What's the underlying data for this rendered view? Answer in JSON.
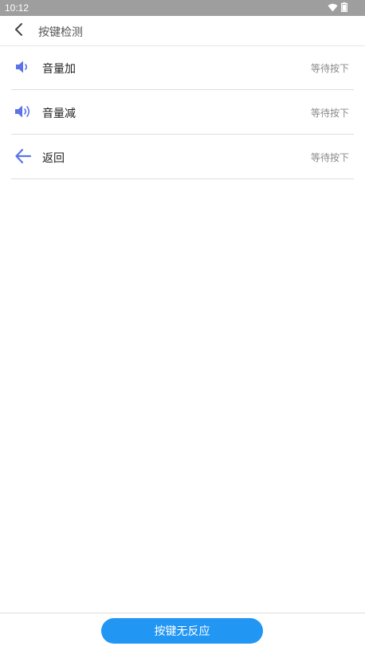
{
  "status_bar": {
    "time": "10:12",
    "icons": [
      "wifi-icon",
      "battery-icon"
    ]
  },
  "header": {
    "back_icon": "chevron-left-icon",
    "title": "按键检测"
  },
  "keys": [
    {
      "icon": "volume-up-icon",
      "label": "音量加",
      "status": "等待按下"
    },
    {
      "icon": "volume-down-icon",
      "label": "音量减",
      "status": "等待按下"
    },
    {
      "icon": "back-arrow-icon",
      "label": "返回",
      "status": "等待按下"
    }
  ],
  "footer": {
    "button_label": "按键无反应"
  },
  "colors": {
    "accent": "#2196f3",
    "icon": "#5b73e8",
    "status_bar": "#9e9e9e"
  }
}
